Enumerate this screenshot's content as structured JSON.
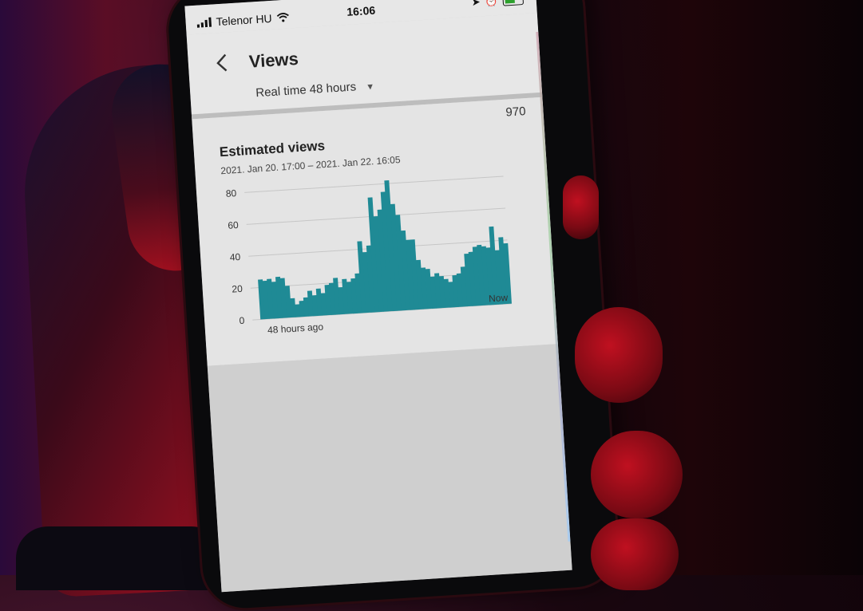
{
  "status_bar": {
    "carrier": "Telenor HU",
    "time": "16:06"
  },
  "header": {
    "title": "Views",
    "back_icon": "chevron-left-icon",
    "range_label": "Real time 48 hours",
    "range_icon": "caret-down-icon"
  },
  "card": {
    "total": "970",
    "title": "Estimated views",
    "subtitle": "2021. Jan 20. 17:00 – 2021. Jan 22. 16:05"
  },
  "colors": {
    "bars": "#1f8a95",
    "grid": "#c6c6c6",
    "text": "#333333"
  },
  "chart_data": {
    "type": "bar",
    "title": "Estimated views",
    "subtitle": "2021. Jan 20. 17:00 – 2021. Jan 22. 16:05",
    "x_start_label": "48 hours ago",
    "x_end_label": "Now",
    "y_ticks": [
      "0",
      "20",
      "40",
      "60",
      "80"
    ],
    "ylim": [
      0,
      80
    ],
    "grid": true,
    "values": [
      25,
      24,
      25,
      23,
      26,
      25,
      20,
      12,
      8,
      10,
      12,
      16,
      13,
      17,
      14,
      19,
      20,
      23,
      17,
      22,
      20,
      22,
      25,
      45,
      38,
      42,
      72,
      60,
      64,
      75,
      82,
      67,
      60,
      50,
      44,
      44,
      31,
      26,
      25,
      20,
      22,
      20,
      18,
      16,
      20,
      21,
      25,
      33,
      34,
      37,
      38,
      37,
      36,
      49,
      34,
      42,
      38
    ]
  }
}
